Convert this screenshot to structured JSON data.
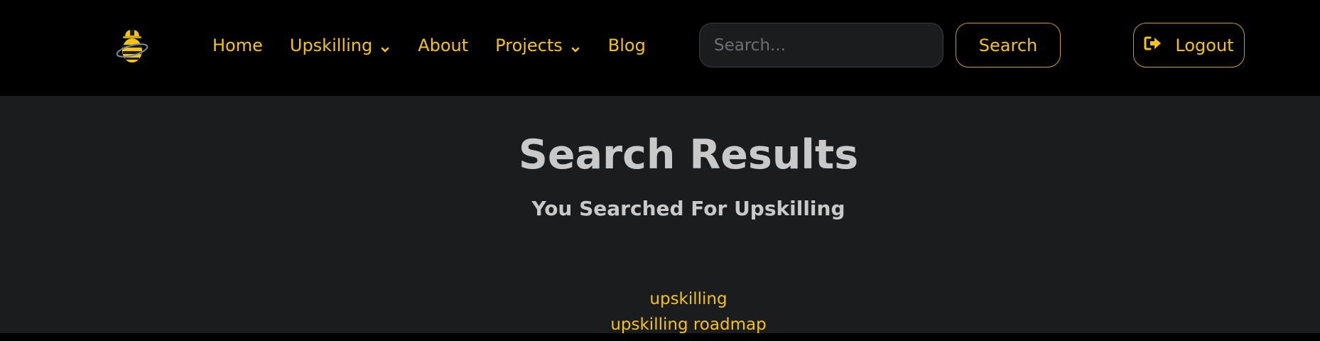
{
  "nav": {
    "logo_icon": "bee-hardhat-logo-icon",
    "links": [
      {
        "label": "Home",
        "dropdown": false
      },
      {
        "label": "Upskilling",
        "dropdown": true
      },
      {
        "label": "About",
        "dropdown": false
      },
      {
        "label": "Projects",
        "dropdown": true
      },
      {
        "label": "Blog",
        "dropdown": false
      }
    ]
  },
  "search": {
    "placeholder": "Search...",
    "value": "",
    "button_label": "Search"
  },
  "logout": {
    "label": "Logout",
    "icon": "sign-out-icon"
  },
  "main": {
    "title": "Search Results",
    "subtitle": "You Searched For Upskilling",
    "results": [
      "upskilling",
      "upskilling roadmap"
    ]
  },
  "colors": {
    "accent": "#f5c315",
    "nav_bg": "#000000",
    "content_bg": "#1b1c1e",
    "heading_text": "#c9c9c9"
  }
}
